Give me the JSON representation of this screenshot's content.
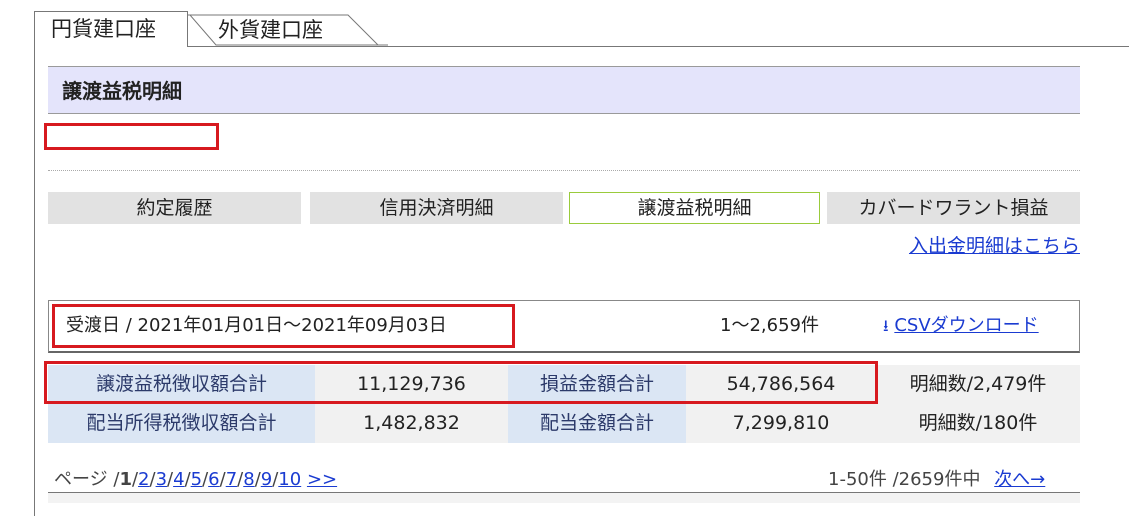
{
  "account_tabs": [
    {
      "label": "円貨建口座",
      "active": true
    },
    {
      "label": "外貨建口座",
      "active": false
    }
  ],
  "page_title": "譲渡益税明細",
  "nav_tabs": [
    {
      "label": "約定履歴",
      "selected": false
    },
    {
      "label": "信用決済明細",
      "selected": false
    },
    {
      "label": "譲渡益税明細",
      "selected": true
    },
    {
      "label": "カバードワラント損益",
      "selected": false
    }
  ],
  "deposit_link": "入出金明細はこちら",
  "filter": {
    "date_range": "受渡日 / 2021年01月01日～2021年09月03日",
    "count": "1～2,659件",
    "csv_icon": "download-arrow-icon",
    "csv_label": "CSVダウンロード"
  },
  "summary_rows": [
    {
      "label1": "譲渡益税徴収額合計",
      "value1": "11,129,736",
      "label2": "損益金額合計",
      "value2": "54,786,564",
      "detail": "明細数/2,479件"
    },
    {
      "label1": "配当所得税徴収額合計",
      "value1": "1,482,832",
      "label2": "配当金額合計",
      "value2": "7,299,810",
      "detail": "明細数/180件"
    }
  ],
  "pagination": {
    "prefix": "ページ /",
    "current": "1",
    "pages": [
      "2",
      "3",
      "4",
      "5",
      "6",
      "7",
      "8",
      "9",
      "10"
    ],
    "more": ">>",
    "range_info": "1-50件 /2659件中",
    "next": "次へ→"
  },
  "colors": {
    "highlight_box": "#d7191f",
    "link": "#1a3bd1",
    "title_bar": "#e4e4fb",
    "selected_tab_border": "#9acb3c",
    "label_cell": "#dbe6f4"
  }
}
